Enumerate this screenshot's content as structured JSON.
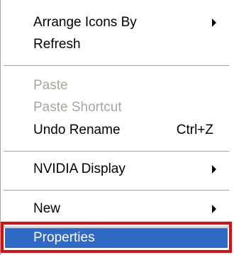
{
  "menu": {
    "items": [
      {
        "label": "Arrange Icons By",
        "submenu": true,
        "disabled": false
      },
      {
        "label": "Refresh",
        "submenu": false,
        "disabled": false
      },
      {
        "label": "Paste",
        "submenu": false,
        "disabled": true
      },
      {
        "label": "Paste Shortcut",
        "submenu": false,
        "disabled": true
      },
      {
        "label": "Undo Rename",
        "shortcut": "Ctrl+Z",
        "submenu": false,
        "disabled": false
      },
      {
        "label": "NVIDIA Display",
        "submenu": true,
        "disabled": false
      },
      {
        "label": "New",
        "submenu": true,
        "disabled": false
      },
      {
        "label": "Properties",
        "submenu": false,
        "disabled": false,
        "selected": true
      }
    ]
  },
  "colors": {
    "selection_background": "#316ac5",
    "selection_text": "#ffffff",
    "disabled_text": "#a9a69f",
    "highlight_frame": "#e10b0b",
    "separator": "#a5a5a5"
  }
}
